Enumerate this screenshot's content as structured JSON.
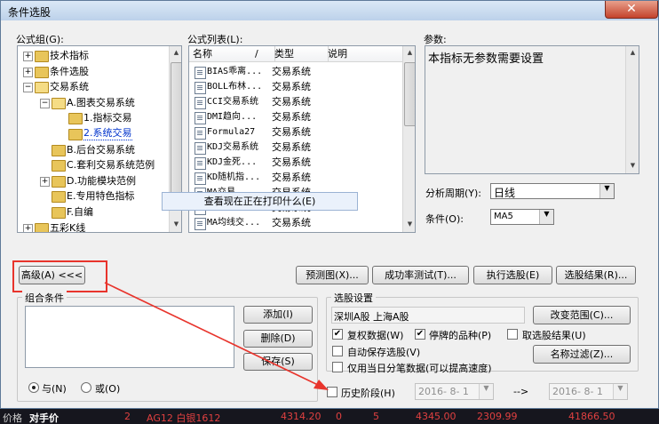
{
  "window": {
    "title": "条件选股",
    "close_glyph": "✕"
  },
  "formula_group": {
    "label": "公式组(G):",
    "items": [
      {
        "label": "技术指标",
        "depth": 0,
        "expander": "+"
      },
      {
        "label": "条件选股",
        "depth": 0,
        "expander": "+"
      },
      {
        "label": "交易系统",
        "depth": 0,
        "expander": "−"
      },
      {
        "label": "A.图表交易系统",
        "depth": 1,
        "expander": "−"
      },
      {
        "label": "1.指标交易",
        "depth": 2,
        "expander": ""
      },
      {
        "label": "2.系统交易",
        "depth": 2,
        "expander": "",
        "selected": true
      },
      {
        "label": "B.后台交易系统",
        "depth": 1,
        "expander": ""
      },
      {
        "label": "C.套利交易系统范例",
        "depth": 1,
        "expander": ""
      },
      {
        "label": "D.功能模块范例",
        "depth": 1,
        "expander": "+"
      },
      {
        "label": "E.专用特色指标",
        "depth": 1,
        "expander": ""
      },
      {
        "label": "F.自编",
        "depth": 1,
        "expander": ""
      },
      {
        "label": "五彩K线",
        "depth": 0,
        "expander": "+"
      }
    ]
  },
  "formula_list": {
    "label": "公式列表(L):",
    "columns": [
      "名称",
      "类型",
      "说明"
    ],
    "sort_glyph": "/",
    "rows": [
      {
        "name": "BIAS乖离...",
        "type": "交易系统"
      },
      {
        "name": "BOLL布林...",
        "type": "交易系统"
      },
      {
        "name": "CCI交易系统",
        "type": "交易系统"
      },
      {
        "name": "DMI趋向...",
        "type": "交易系统"
      },
      {
        "name": "Formula27",
        "type": "交易系统"
      },
      {
        "name": "KDJ交易系统",
        "type": "交易系统"
      },
      {
        "name": "KDJ金死...",
        "type": "交易系统"
      },
      {
        "name": "KD随机指...",
        "type": "交易系统"
      },
      {
        "name": "MA交易...",
        "type": "交易系统"
      },
      {
        "name": "MA均线",
        "type": "交易系统"
      },
      {
        "name": "MA均线交...",
        "type": "交易系统"
      }
    ]
  },
  "params": {
    "label": "参数:",
    "text": "本指标无参数需要设置"
  },
  "period": {
    "label": "分析周期(Y):",
    "value": "日线"
  },
  "condition": {
    "label": "条件(O):",
    "value": "MA5"
  },
  "tooltip": "查看现在正在打印什么(E)",
  "toolbar": {
    "advanced": "高级(A) <<<",
    "preview": "预测图(X)...",
    "success_test": "成功率测试(T)...",
    "execute": "执行选股(E)",
    "result": "选股结果(R)..."
  },
  "combo": {
    "title": "组合条件",
    "add": "添加(I)",
    "delete": "删除(D)",
    "save": "保存(S)",
    "and_label": "与(N)",
    "or_label": "或(O)",
    "mode": "and"
  },
  "stock_setting": {
    "title": "选股设置",
    "range_text": "深圳A股  上海A股",
    "change_range": "改变范围(C)...",
    "checks": [
      {
        "label": "复权数据(W)",
        "checked": true
      },
      {
        "label": "停牌的品种(P)",
        "checked": true
      },
      {
        "label": "取选股结果(U)",
        "checked": false
      },
      {
        "label": "自动保存选股(V)",
        "checked": false
      },
      {
        "label": "仅用当日分笔数据(可以提高速度)",
        "checked": false
      }
    ],
    "name_filter": "名称过滤(Z)..."
  },
  "history": {
    "label": "历史阶段(H)",
    "checked": false,
    "from": "2016- 8- 1",
    "to_glyph": "-->",
    "to": "2016- 8- 1"
  },
  "taskbar": {
    "items": [
      "价格",
      "对手价",
      "2",
      "AG12 白银1612",
      "4314.20",
      "0",
      "5",
      "4345.00",
      "2309.99",
      "41866.50"
    ]
  },
  "colors": {
    "annotation": "#e8342c",
    "taskbar_text": "#e04040",
    "selection": "#3399ff"
  }
}
